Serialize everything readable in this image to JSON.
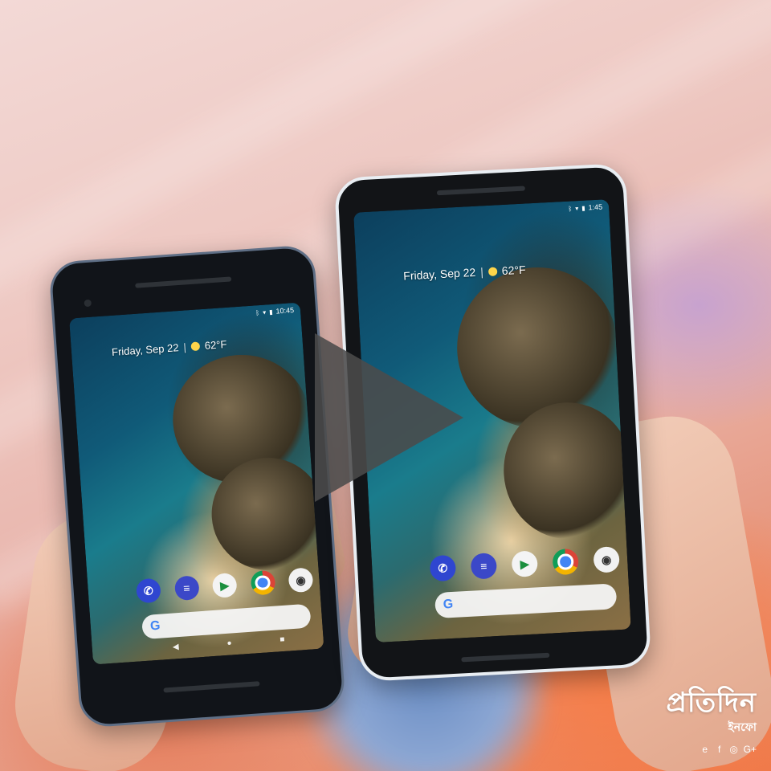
{
  "scene": {
    "colors": {
      "background_top": "#f3d9d6",
      "background_bottom": "#ef7a4b",
      "play_overlay": "#4b4b4b",
      "brand_text": "#ffffff"
    }
  },
  "phones": [
    {
      "id": "small",
      "status_time": "10:45",
      "date_text": "Friday, Sep 22",
      "separator": "|",
      "temperature": "62°F",
      "dock_apps": [
        "phone-icon",
        "messages-icon",
        "play-store-icon",
        "chrome-icon",
        "camera-icon"
      ],
      "search_logo": "G"
    },
    {
      "id": "large",
      "status_time": "1:45",
      "date_text": "Friday, Sep 22",
      "separator": "|",
      "temperature": "62°F",
      "dock_apps": [
        "phone-icon",
        "messages-icon",
        "play-store-icon",
        "chrome-icon",
        "camera-icon"
      ],
      "search_logo": "G"
    }
  ],
  "brand": {
    "logo_text": "প্রতিদিন",
    "sub_text": "ইনফো",
    "social": [
      "e",
      "f",
      "◎",
      "G+"
    ]
  }
}
